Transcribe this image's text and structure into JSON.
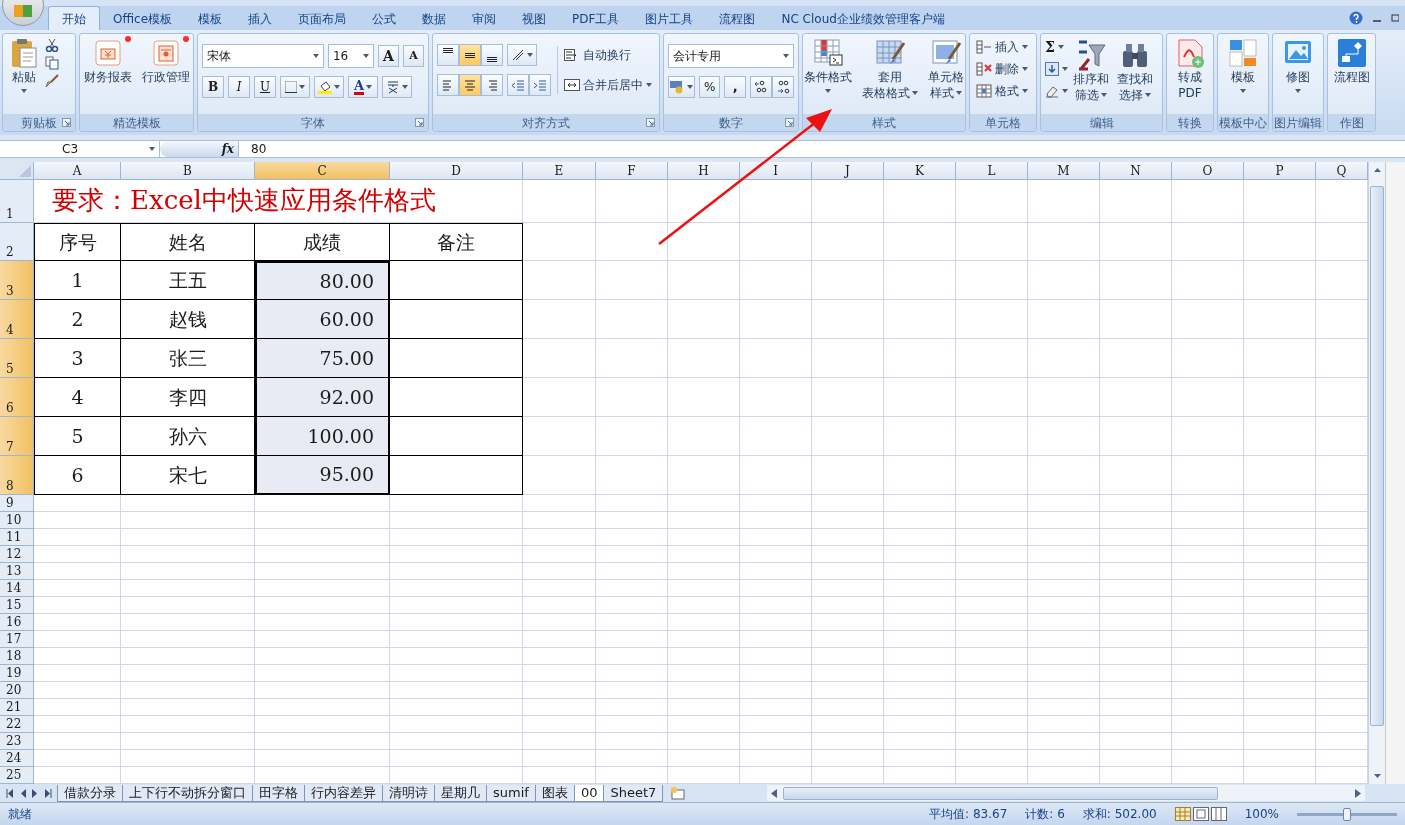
{
  "ribbon_tabs": [
    {
      "label": "开始",
      "selected": true
    },
    {
      "label": "Office模板",
      "selected": false
    },
    {
      "label": "模板",
      "selected": false
    },
    {
      "label": "插入",
      "selected": false
    },
    {
      "label": "页面布局",
      "selected": false
    },
    {
      "label": "公式",
      "selected": false
    },
    {
      "label": "数据",
      "selected": false
    },
    {
      "label": "审阅",
      "selected": false
    },
    {
      "label": "视图",
      "selected": false
    },
    {
      "label": "PDF工具",
      "selected": false
    },
    {
      "label": "图片工具",
      "selected": false
    },
    {
      "label": "流程图",
      "selected": false
    },
    {
      "label": "NC Cloud企业绩效管理客户端",
      "selected": false
    }
  ],
  "ribbon_groups": [
    {
      "kind": "clipboard",
      "title": "剪贴板",
      "launcher": true,
      "items": [
        {
          "kind": "paste",
          "lines": [
            "粘贴"
          ],
          "caret": true
        }
      ]
    },
    {
      "kind": "large",
      "title": "精选模板",
      "launcher": false,
      "items": [
        {
          "kind": "finance",
          "lines": [
            "财务报表"
          ],
          "caret": false,
          "new": true
        },
        {
          "kind": "admin",
          "lines": [
            "行政管理"
          ],
          "caret": false,
          "new": true
        }
      ]
    },
    {
      "kind": "font",
      "title": "字体",
      "launcher": true,
      "font_name": "宋体",
      "font_size": "16",
      "grow": "A",
      "shrink": "A",
      "styles": [
        "B",
        "I",
        "U"
      ],
      "font_color": "A"
    },
    {
      "kind": "align",
      "title": "对齐方式",
      "launcher": true,
      "vertical": [
        {
          "selected": false
        },
        {
          "selected": true
        },
        {
          "selected": false
        }
      ],
      "horizontal": [
        {
          "selected": false
        },
        {
          "selected": true
        },
        {
          "selected": false
        }
      ],
      "wrap_text": "自动换行",
      "merge": "合并后居中"
    },
    {
      "kind": "number",
      "title": "数字",
      "launcher": true,
      "format": "会计专用",
      "percent": "%",
      "comma": ","
    },
    {
      "kind": "large",
      "title": "样式",
      "launcher": false,
      "items": [
        {
          "kind": "conditional",
          "lines": [
            "条件格式"
          ],
          "caret": true
        },
        {
          "kind": "table",
          "lines": [
            "套用",
            "表格格式"
          ],
          "caret": true
        },
        {
          "kind": "cellstyle",
          "lines": [
            "单元格",
            "样式"
          ],
          "caret": true
        }
      ]
    },
    {
      "kind": "small",
      "title": "单元格",
      "launcher": false,
      "items": [
        {
          "kind": "insert",
          "label": "插入",
          "caret": true
        },
        {
          "kind": "delete",
          "label": "删除",
          "caret": true
        },
        {
          "kind": "format",
          "label": "格式",
          "caret": true
        }
      ]
    },
    {
      "kind": "editing",
      "title": "编辑",
      "launcher": false,
      "sum": "Σ",
      "items": [
        {
          "kind": "sort",
          "lines": [
            "排序和",
            "筛选"
          ],
          "caret": true
        },
        {
          "kind": "find",
          "lines": [
            "查找和",
            "选择"
          ],
          "caret": true
        }
      ]
    },
    {
      "kind": "large",
      "title": "转换",
      "launcher": false,
      "items": [
        {
          "kind": "pdf",
          "lines": [
            "转成",
            "PDF"
          ],
          "caret": false
        }
      ]
    },
    {
      "kind": "large",
      "title": "模板中心",
      "launcher": false,
      "items": [
        {
          "kind": "template",
          "lines": [
            "模板"
          ],
          "caret": true
        }
      ]
    },
    {
      "kind": "large",
      "title": "图片编辑",
      "launcher": false,
      "items": [
        {
          "kind": "image",
          "lines": [
            "修图"
          ],
          "caret": true
        }
      ]
    },
    {
      "kind": "large",
      "title": "作图",
      "launcher": false,
      "items": [
        {
          "kind": "flowchart",
          "lines": [
            "流程图"
          ],
          "caret": false
        }
      ]
    }
  ],
  "formula_bar": {
    "name_box": "C3",
    "function_label": "fx",
    "value": "80"
  },
  "sheet": {
    "columns": [
      {
        "label": "A",
        "selected": false
      },
      {
        "label": "B",
        "selected": false
      },
      {
        "label": "C",
        "selected": true
      },
      {
        "label": "D",
        "selected": false
      },
      {
        "label": "E",
        "selected": false
      },
      {
        "label": "F",
        "selected": false
      },
      {
        "label": "H",
        "selected": false
      },
      {
        "label": "I",
        "selected": false
      },
      {
        "label": "J",
        "selected": false
      },
      {
        "label": "K",
        "selected": false
      },
      {
        "label": "L",
        "selected": false
      },
      {
        "label": "M",
        "selected": false
      },
      {
        "label": "N",
        "selected": false
      },
      {
        "label": "O",
        "selected": false
      },
      {
        "label": "P",
        "selected": false
      },
      {
        "label": "Q",
        "selected": false
      }
    ],
    "rows": [
      {
        "label": "1",
        "selected": false,
        "cells": [
          {
            "kind": "title",
            "text": "要求：Excel中快速应用条件格式"
          }
        ]
      },
      {
        "label": "2",
        "selected": false,
        "cells": [
          {
            "kind": "header",
            "text": "序号"
          },
          {
            "kind": "header",
            "text": "姓名"
          },
          {
            "kind": "header",
            "text": "成绩"
          },
          {
            "kind": "header",
            "text": "备注"
          }
        ]
      },
      {
        "label": "3",
        "selected": true,
        "cells": [
          {
            "kind": "text",
            "text": "1"
          },
          {
            "kind": "text",
            "text": "王五"
          },
          {
            "kind": "number",
            "text": "80.00",
            "selected": true
          },
          {
            "kind": "blank"
          }
        ]
      },
      {
        "label": "4",
        "selected": true,
        "cells": [
          {
            "kind": "text",
            "text": "2"
          },
          {
            "kind": "text",
            "text": "赵钱"
          },
          {
            "kind": "number",
            "text": "60.00",
            "selected": true
          },
          {
            "kind": "blank"
          }
        ]
      },
      {
        "label": "5",
        "selected": true,
        "cells": [
          {
            "kind": "text",
            "text": "3"
          },
          {
            "kind": "text",
            "text": "张三"
          },
          {
            "kind": "number",
            "text": "75.00",
            "selected": true
          },
          {
            "kind": "blank"
          }
        ]
      },
      {
        "label": "6",
        "selected": true,
        "cells": [
          {
            "kind": "text",
            "text": "4"
          },
          {
            "kind": "text",
            "text": "李四"
          },
          {
            "kind": "number",
            "text": "92.00",
            "selected": true
          },
          {
            "kind": "blank"
          }
        ]
      },
      {
        "label": "7",
        "selected": true,
        "cells": [
          {
            "kind": "text",
            "text": "5"
          },
          {
            "kind": "text",
            "text": "孙六"
          },
          {
            "kind": "number",
            "text": "100.00",
            "selected": true
          },
          {
            "kind": "blank"
          }
        ]
      },
      {
        "label": "8",
        "selected": true,
        "cells": [
          {
            "kind": "text",
            "text": "6"
          },
          {
            "kind": "text",
            "text": "宋七"
          },
          {
            "kind": "number",
            "text": "95.00",
            "selected": true
          },
          {
            "kind": "blank"
          }
        ]
      },
      {
        "label": "9",
        "selected": false
      },
      {
        "label": "10",
        "selected": false
      },
      {
        "label": "11",
        "selected": false
      },
      {
        "label": "12",
        "selected": false
      },
      {
        "label": "13",
        "selected": false
      },
      {
        "label": "14",
        "selected": false
      },
      {
        "label": "15",
        "selected": false
      },
      {
        "label": "16",
        "selected": false
      },
      {
        "label": "17",
        "selected": false
      },
      {
        "label": "18",
        "selected": false
      },
      {
        "label": "19",
        "selected": false
      },
      {
        "label": "20",
        "selected": false
      },
      {
        "label": "21",
        "selected": false
      },
      {
        "label": "22",
        "selected": false
      },
      {
        "label": "23",
        "selected": false
      },
      {
        "label": "24",
        "selected": false
      },
      {
        "label": "25",
        "selected": false
      }
    ]
  },
  "sheet_tabs": [
    {
      "label": "借款分录",
      "selected": false
    },
    {
      "label": "上下行不动拆分窗口",
      "selected": false
    },
    {
      "label": "田字格",
      "selected": false
    },
    {
      "label": "行内容差异",
      "selected": false
    },
    {
      "label": "清明诗",
      "selected": false
    },
    {
      "label": "星期几",
      "selected": false
    },
    {
      "label": "sumif",
      "selected": false
    },
    {
      "label": "图表",
      "selected": false
    },
    {
      "label": "00",
      "selected": true
    },
    {
      "label": "Sheet7",
      "selected": false
    }
  ],
  "status_bar": {
    "status": "就绪",
    "average": "平均值: 83.67",
    "count": "计数: 6",
    "sum": "求和: 502.00",
    "zoom": "100%",
    "level": 0.5
  }
}
